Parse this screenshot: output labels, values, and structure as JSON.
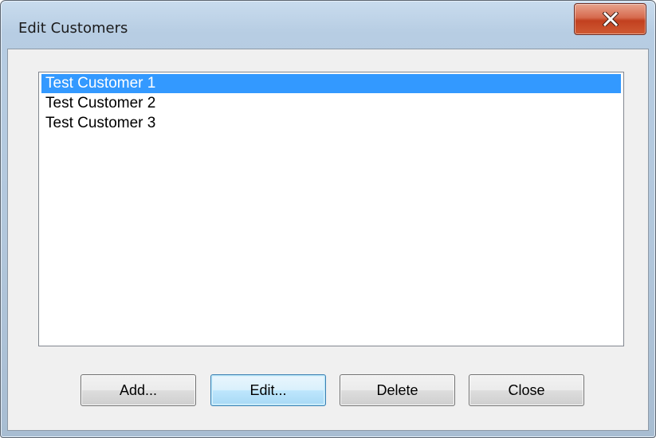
{
  "window": {
    "title": "Edit Customers",
    "close_symbol": "x"
  },
  "customers": {
    "items": [
      {
        "label": "Test Customer 1",
        "selected": true
      },
      {
        "label": "Test Customer 2",
        "selected": false
      },
      {
        "label": "Test Customer 3",
        "selected": false
      }
    ],
    "selection_color": "#3399ff"
  },
  "buttons": {
    "add": "Add...",
    "edit": "Edit...",
    "delete": "Delete",
    "close": "Close"
  },
  "icons": {
    "close": "close-icon"
  },
  "colors": {
    "close_button": "#c2401f",
    "default_button_border": "#3c7fb1"
  }
}
